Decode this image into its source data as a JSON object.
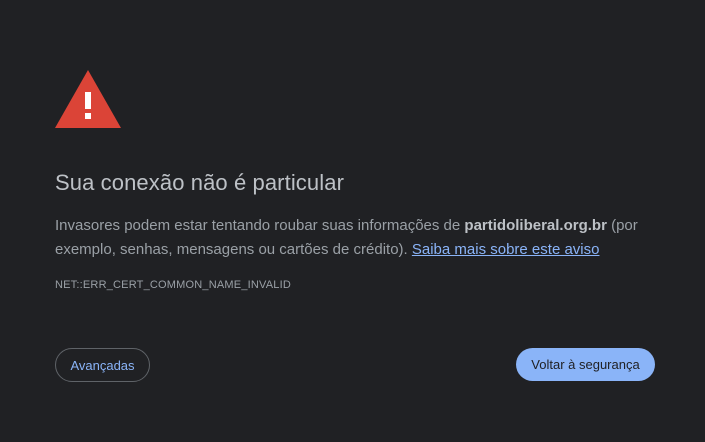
{
  "icon": "warning-triangle-icon",
  "colors": {
    "background": "#202124",
    "warning": "#db4437",
    "link": "#8ab4f8",
    "text": "#9aa0a6",
    "title": "#bdc1c6"
  },
  "title": "Sua conexão não é particular",
  "message": {
    "before": "Invasores podem estar tentando roubar suas informações de ",
    "host": "partidoliberal.org.br",
    "after": " (por exemplo, senhas, mensagens ou cartões de crédito). ",
    "link": "Saiba mais sobre este aviso"
  },
  "error_code": "NET::ERR_CERT_COMMON_NAME_INVALID",
  "buttons": {
    "advanced": "Avançadas",
    "back_to_safety": "Voltar à segurança"
  }
}
